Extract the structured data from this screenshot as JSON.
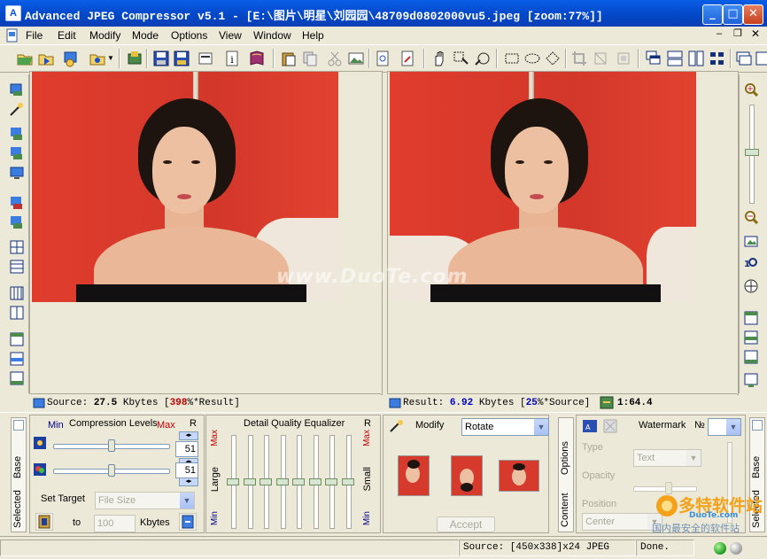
{
  "window": {
    "title": "Advanced JPEG Compressor v5.1 - [E:\\图片\\明星\\刘园园\\48709d0802000vu5.jpeg  [zoom:77%]]"
  },
  "menu": [
    "File",
    "Edit",
    "Modify",
    "Mode",
    "Options",
    "View",
    "Window",
    "Help"
  ],
  "source_status": {
    "prefix": "Source:",
    "value": "27.5",
    "unit": "Kbytes",
    "pct": "398",
    "suffix": "%*Result]"
  },
  "result_status": {
    "prefix": "Result:",
    "value": "6.92",
    "unit": "Kbytes",
    "pct": "25",
    "suffix": "%*Source]",
    "ratio": "1:64.4"
  },
  "compression": {
    "title": "Compression Levels",
    "min_label": "Min",
    "max_label": "Max",
    "r_label": "R",
    "level1": 51,
    "level2": 51,
    "level1_pct": 0.5,
    "level2_pct": 0.5,
    "set_target_label": "Set Target",
    "target_mode": "File Size",
    "to_label": "to",
    "target_value": "100",
    "target_unit": "Kbytes"
  },
  "side_tabs_left": [
    "Base",
    "Selected"
  ],
  "equalizer": {
    "title": "Detail Quality Equalizer",
    "r_label": "R",
    "max_label": "Max",
    "min_label": "Min",
    "large_label": "Large",
    "small_label": "Small",
    "bands": [
      0.5,
      0.5,
      0.5,
      0.5,
      0.5,
      0.5,
      0.5,
      0.5
    ]
  },
  "modify": {
    "title": "Modify",
    "action": "Rotate",
    "accept_label": "Accept"
  },
  "side_tabs_mid": [
    "Options",
    "Content"
  ],
  "watermark": {
    "title": "Watermark",
    "number_label": "№",
    "type_label": "Type",
    "type_value": "Text",
    "opacity_label": "Opacity",
    "position_label": "Position",
    "position_value": "Center"
  },
  "side_tabs_right": [
    "Base",
    "Selected"
  ],
  "overlay_watermark": "www.DuoTe.com",
  "logo": {
    "cn": "多特软件站",
    "url": "DuoTe.com",
    "slogan": "国内最安全的软件站"
  },
  "statusbar": {
    "source_info": "Source: [450x338]x24 JPEG",
    "state": "Done."
  },
  "colors": {
    "title_bar": "#0348c8",
    "pct_red": "#c00000",
    "value_blue": "#0000c0",
    "background": "#ece9d8"
  }
}
